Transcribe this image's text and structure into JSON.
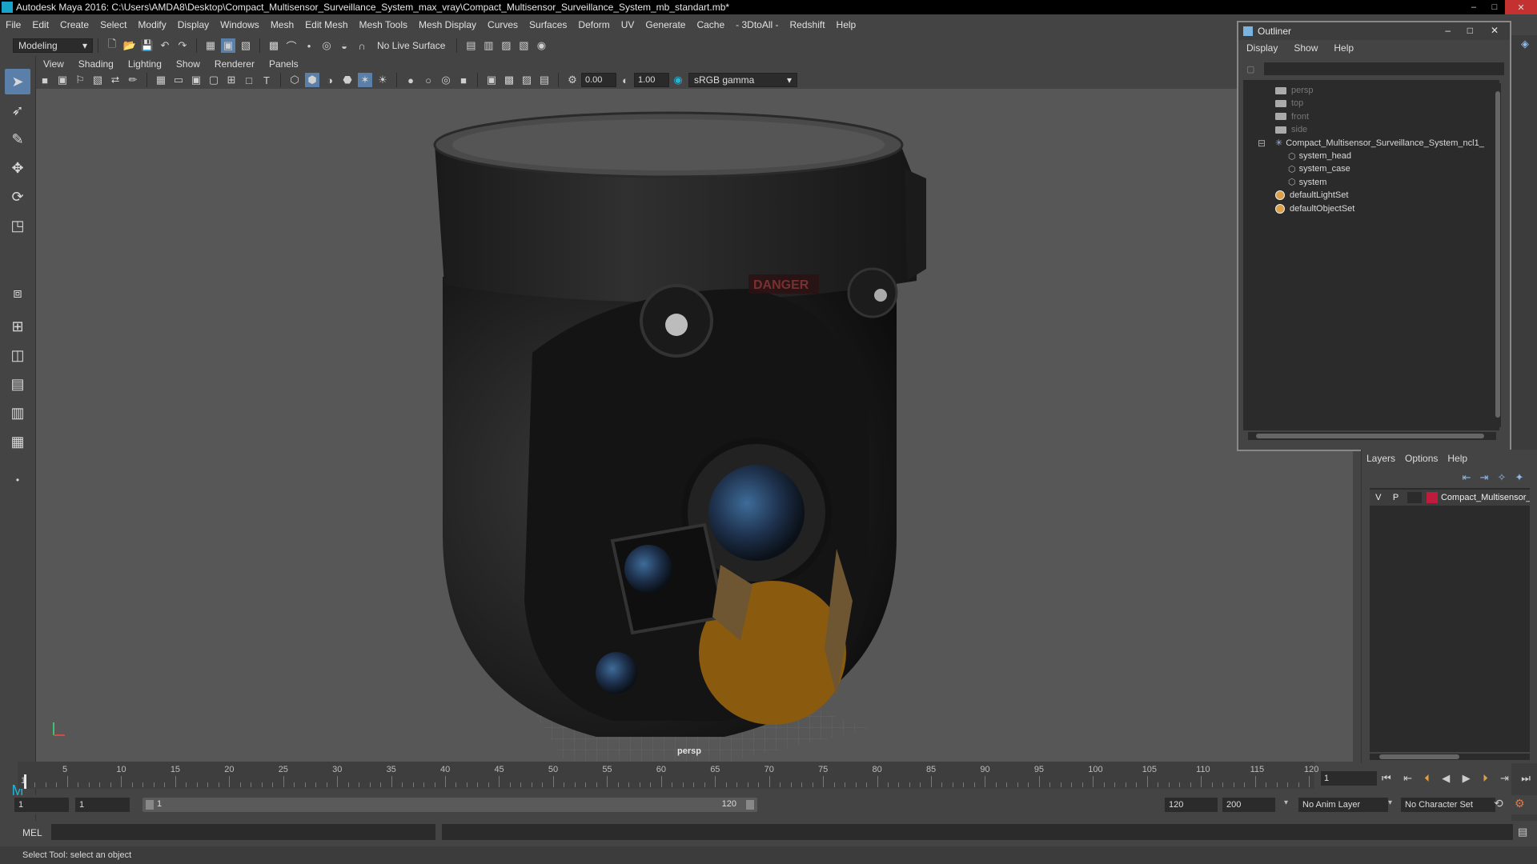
{
  "title": "Autodesk Maya 2016: C:\\Users\\AMDA8\\Desktop\\Compact_Multisensor_Surveillance_System_max_vray\\Compact_Multisensor_Surveillance_System_mb_standart.mb*",
  "menu": [
    "File",
    "Edit",
    "Create",
    "Select",
    "Modify",
    "Display",
    "Windows",
    "Mesh",
    "Edit Mesh",
    "Mesh Tools",
    "Mesh Display",
    "Curves",
    "Surfaces",
    "Deform",
    "UV",
    "Generate",
    "Cache",
    "- 3DtoAll -",
    "Redshift",
    "Help"
  ],
  "shelf": {
    "mode": "Modeling",
    "live_surface": "No Live Surface"
  },
  "panel_menu": [
    "View",
    "Shading",
    "Lighting",
    "Show",
    "Renderer",
    "Panels"
  ],
  "panel_bar": {
    "exposure": "0.00",
    "gamma": "1.00",
    "colorspace": "sRGB gamma"
  },
  "viewport": {
    "camera_label": "persp",
    "decal_text": "DANGER"
  },
  "outliner": {
    "title": "Outliner",
    "menu": [
      "Display",
      "Show",
      "Help"
    ],
    "items": [
      {
        "label": "persp",
        "kind": "camera",
        "dim": true
      },
      {
        "label": "top",
        "kind": "camera",
        "dim": true
      },
      {
        "label": "front",
        "kind": "camera",
        "dim": true
      },
      {
        "label": "side",
        "kind": "camera",
        "dim": true
      },
      {
        "label": "Compact_Multisensor_Surveillance_System_ncl1_",
        "kind": "group",
        "dim": false
      },
      {
        "label": "system_head",
        "kind": "mesh",
        "dim": false
      },
      {
        "label": "system_case",
        "kind": "mesh",
        "dim": false
      },
      {
        "label": "system",
        "kind": "mesh",
        "dim": false
      },
      {
        "label": "defaultLightSet",
        "kind": "set",
        "dim": false
      },
      {
        "label": "defaultObjectSet",
        "kind": "set",
        "dim": false
      }
    ]
  },
  "layers": {
    "menu": [
      "Layers",
      "Options",
      "Help"
    ],
    "row": {
      "v": "V",
      "p": "P",
      "name": "Compact_Multisensor_",
      "color": "#c01a3d"
    }
  },
  "timeline": {
    "ticks": [
      "5",
      "10",
      "15",
      "20",
      "25",
      "30",
      "35",
      "40",
      "45",
      "50",
      "55",
      "60",
      "65",
      "70",
      "75",
      "80",
      "85",
      "90",
      "95",
      "100",
      "105",
      "110",
      "115",
      "120"
    ],
    "start_label": "1",
    "current_frame": "1"
  },
  "range": {
    "start": "1",
    "playback_start": "1",
    "slider_start": "1",
    "slider_end": "120",
    "playback_end": "120",
    "end": "200",
    "anim_layer": "No Anim Layer",
    "character_set": "No Character Set"
  },
  "cmd": {
    "label": "MEL"
  },
  "status": "Select Tool: select an object"
}
